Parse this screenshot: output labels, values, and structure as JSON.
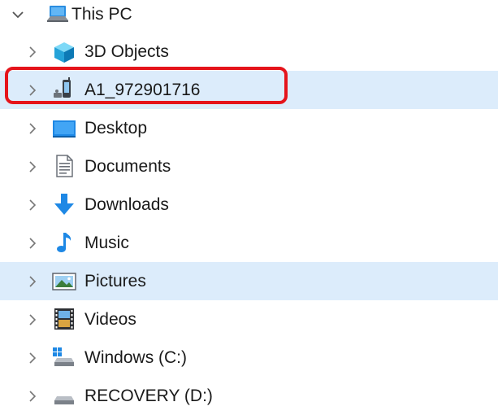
{
  "tree": {
    "root": {
      "label": "This PC",
      "icon": "this-pc-icon",
      "expanded": true
    },
    "items": [
      {
        "label": "3D Objects",
        "icon": "3d-objects-icon",
        "highlighted": false
      },
      {
        "label": "A1_972901716",
        "icon": "phone-device-icon",
        "highlighted": true,
        "outlined": true
      },
      {
        "label": "Desktop",
        "icon": "desktop-icon",
        "highlighted": false
      },
      {
        "label": "Documents",
        "icon": "documents-icon",
        "highlighted": false
      },
      {
        "label": "Downloads",
        "icon": "downloads-icon",
        "highlighted": false
      },
      {
        "label": "Music",
        "icon": "music-icon",
        "highlighted": false
      },
      {
        "label": "Pictures",
        "icon": "pictures-icon",
        "highlighted": true
      },
      {
        "label": "Videos",
        "icon": "videos-icon",
        "highlighted": false
      },
      {
        "label": "Windows (C:)",
        "icon": "windows-drive-icon",
        "highlighted": false
      },
      {
        "label": "RECOVERY (D:)",
        "icon": "drive-icon",
        "highlighted": false
      }
    ]
  },
  "colors": {
    "hover_highlight": "#dcecfb",
    "annotation_outline": "#e5141b"
  }
}
